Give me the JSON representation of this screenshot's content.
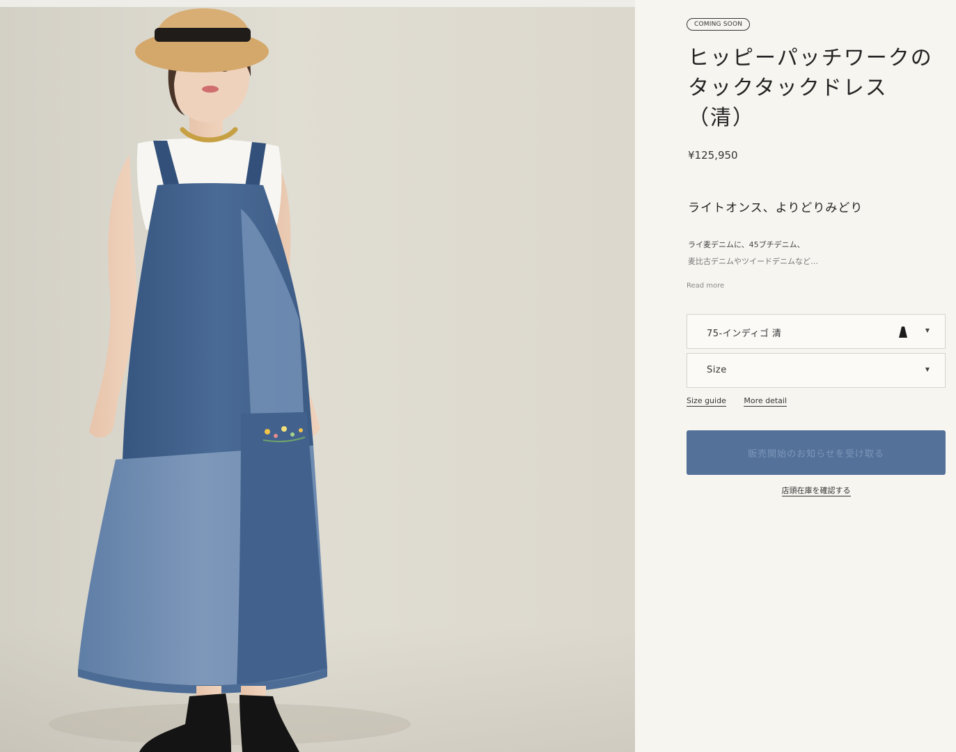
{
  "product": {
    "badge": "COMING SOON",
    "title_lines": [
      "ヒッピーパッチワークの",
      "タックタックドレス",
      "（清）"
    ],
    "price": "¥125,950",
    "subheading": "ライトオンス、よりどりみどり",
    "description_lines": [
      "ライ麦デニムに、45ブチデニム、",
      "麦比古デニムやツイードデニムなど…"
    ],
    "read_more": "Read more"
  },
  "options": {
    "color_label": "75-インディゴ 清",
    "size_label": "Size",
    "size_guide": "Size guide",
    "more_detail": "More detail"
  },
  "actions": {
    "notify_button": "販売開始のお知らせを受け取る",
    "store_stock_link": "店頭在庫を確認する"
  },
  "colors": {
    "cta_background": "#54719a",
    "denim_dark": "#3f5d86",
    "denim_light": "#7892b4",
    "background": "#f6f5f0"
  },
  "icons": {
    "dropdown": "chevron-down-icon",
    "color_swatch": "dress-swatch-icon"
  }
}
